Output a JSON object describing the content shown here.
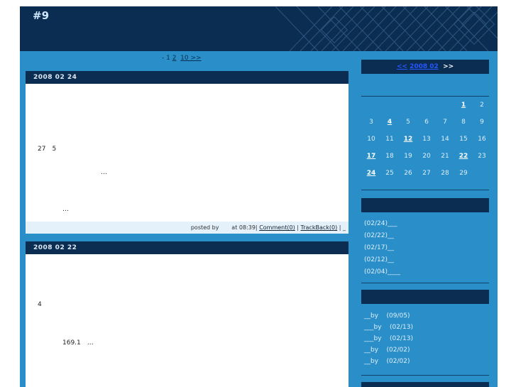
{
  "site": {
    "title": "#9"
  },
  "pager": {
    "prefix": "- 1 ",
    "page2": "2",
    "next": "10 >>"
  },
  "entries": [
    {
      "date": "2008 02 24",
      "lines": [
        "27　5",
        "…",
        "…"
      ],
      "footer": {
        "posted_by": "posted by",
        "time": "at 08:39|",
        "comment": "Comment(0)",
        "sep": "|",
        "trackback": "TrackBack(0)",
        "tail": "| _"
      }
    },
    {
      "date": "2008 02 22",
      "lines": [
        "4",
        "169.1　…"
      ]
    }
  ],
  "calendar": {
    "prev": "<<",
    "month_link": "2008 02",
    "next": ">>",
    "days": [
      {
        "d": "1",
        "link": true
      },
      {
        "d": "2",
        "link": false
      },
      {
        "d": "3",
        "link": false
      },
      {
        "d": "4",
        "link": true
      },
      {
        "d": "5",
        "link": false
      },
      {
        "d": "6",
        "link": false
      },
      {
        "d": "7",
        "link": false
      },
      {
        "d": "8",
        "link": false
      },
      {
        "d": "9",
        "link": false
      },
      {
        "d": "10",
        "link": false
      },
      {
        "d": "11",
        "link": false
      },
      {
        "d": "12",
        "link": true
      },
      {
        "d": "13",
        "link": false
      },
      {
        "d": "14",
        "link": false
      },
      {
        "d": "15",
        "link": false
      },
      {
        "d": "16",
        "link": false
      },
      {
        "d": "17",
        "link": true
      },
      {
        "d": "18",
        "link": false
      },
      {
        "d": "19",
        "link": false
      },
      {
        "d": "20",
        "link": false
      },
      {
        "d": "21",
        "link": false
      },
      {
        "d": "22",
        "link": true
      },
      {
        "d": "23",
        "link": false
      },
      {
        "d": "24",
        "link": true
      },
      {
        "d": "25",
        "link": false
      },
      {
        "d": "26",
        "link": false
      },
      {
        "d": "27",
        "link": false
      },
      {
        "d": "28",
        "link": false
      },
      {
        "d": "29",
        "link": false
      }
    ]
  },
  "recent_entries": [
    "(02/24)___",
    "(02/22)__",
    "(02/17)__",
    "(02/12)__",
    "(02/04)____"
  ],
  "recent_comments": [
    {
      "who": "__by",
      "date": "(09/05)"
    },
    {
      "who": "___by",
      "date": "(02/13)"
    },
    {
      "who": "___by",
      "date": "(02/13)"
    },
    {
      "who": "__by",
      "date": "(02/02)"
    },
    {
      "who": "__by",
      "date": "(02/02)"
    }
  ]
}
